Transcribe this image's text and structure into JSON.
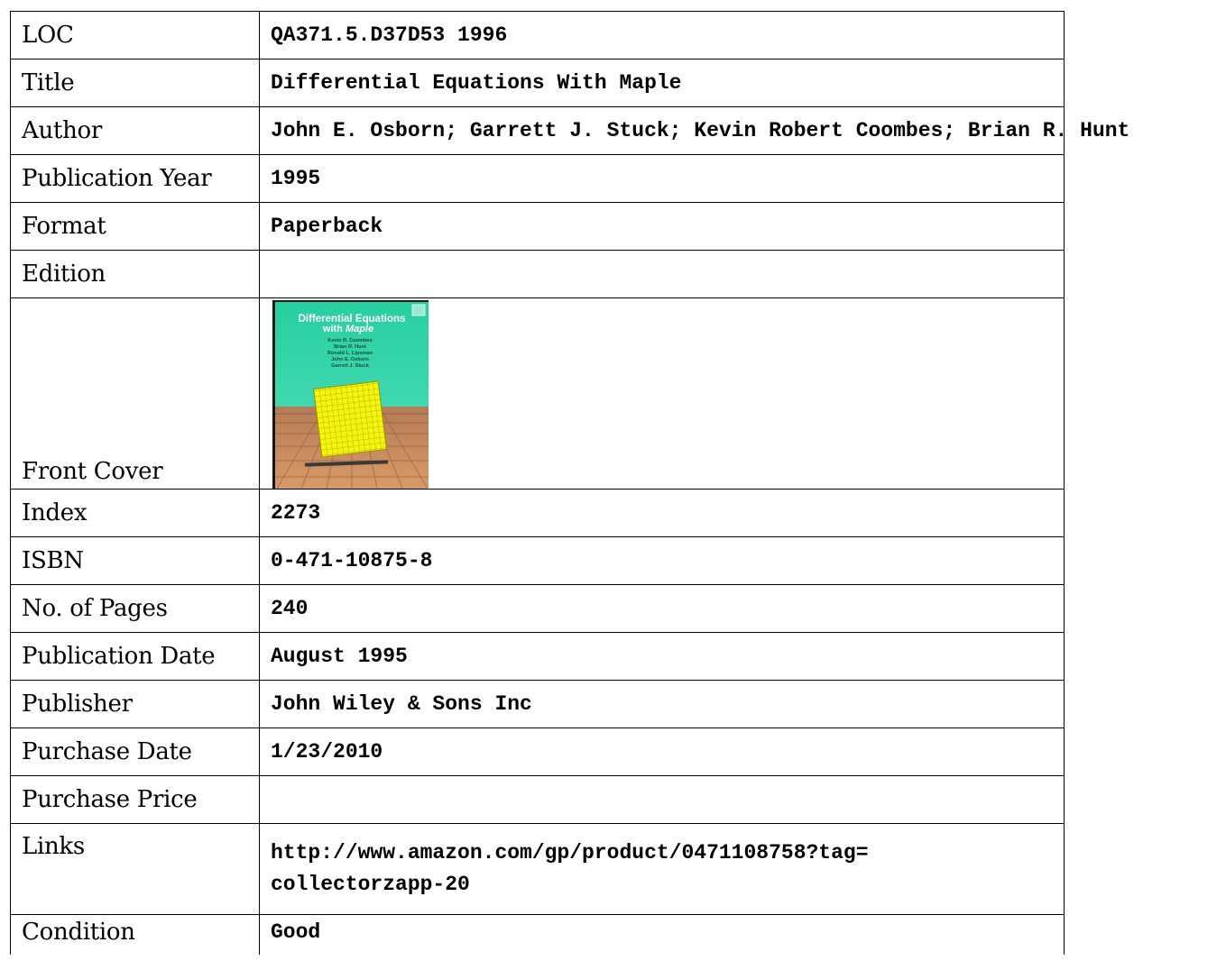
{
  "record": {
    "loc": {
      "label": "LOC",
      "value": "QA371.5.D37D53 1996"
    },
    "title": {
      "label": "Title",
      "value": "Differential Equations With Maple"
    },
    "author": {
      "label": "Author",
      "value": "John E. Osborn; Garrett J. Stuck; Kevin Robert Coombes; Brian R. Hunt"
    },
    "publication_year": {
      "label": "Publication Year",
      "value": "1995"
    },
    "format": {
      "label": "Format",
      "value": "Paperback"
    },
    "edition": {
      "label": "Edition",
      "value": ""
    },
    "front_cover": {
      "label": "Front Cover",
      "cover_title_line1": "Differential Equations",
      "cover_title_line2_prefix": "with ",
      "cover_title_line2_italic": "Maple",
      "cover_authors": [
        "Kevin R. Coombes",
        "Brian R. Hunt",
        "Ronald L. Lipsman",
        "John E. Osborn",
        "Garrett J. Stuck"
      ],
      "colors": {
        "background": "#2fd0a0",
        "floor": "#c8875a",
        "surface": "#f2f20c"
      }
    },
    "index": {
      "label": "Index",
      "value": "2273"
    },
    "isbn": {
      "label": "ISBN",
      "value": "0-471-10875-8"
    },
    "pages": {
      "label": "No. of Pages",
      "value": "240"
    },
    "publication_date": {
      "label": "Publication Date",
      "value": "August 1995"
    },
    "publisher": {
      "label": "Publisher",
      "value": "John Wiley & Sons Inc"
    },
    "purchase_date": {
      "label": "Purchase Date",
      "value": "1/23/2010"
    },
    "purchase_price": {
      "label": "Purchase Price",
      "value": ""
    },
    "links": {
      "label": "Links",
      "line1": "http://www.amazon.com/gp/product/0471108758?tag=",
      "line2": "collectorzapp-20"
    },
    "condition": {
      "label": "Condition",
      "value": "Good"
    }
  }
}
